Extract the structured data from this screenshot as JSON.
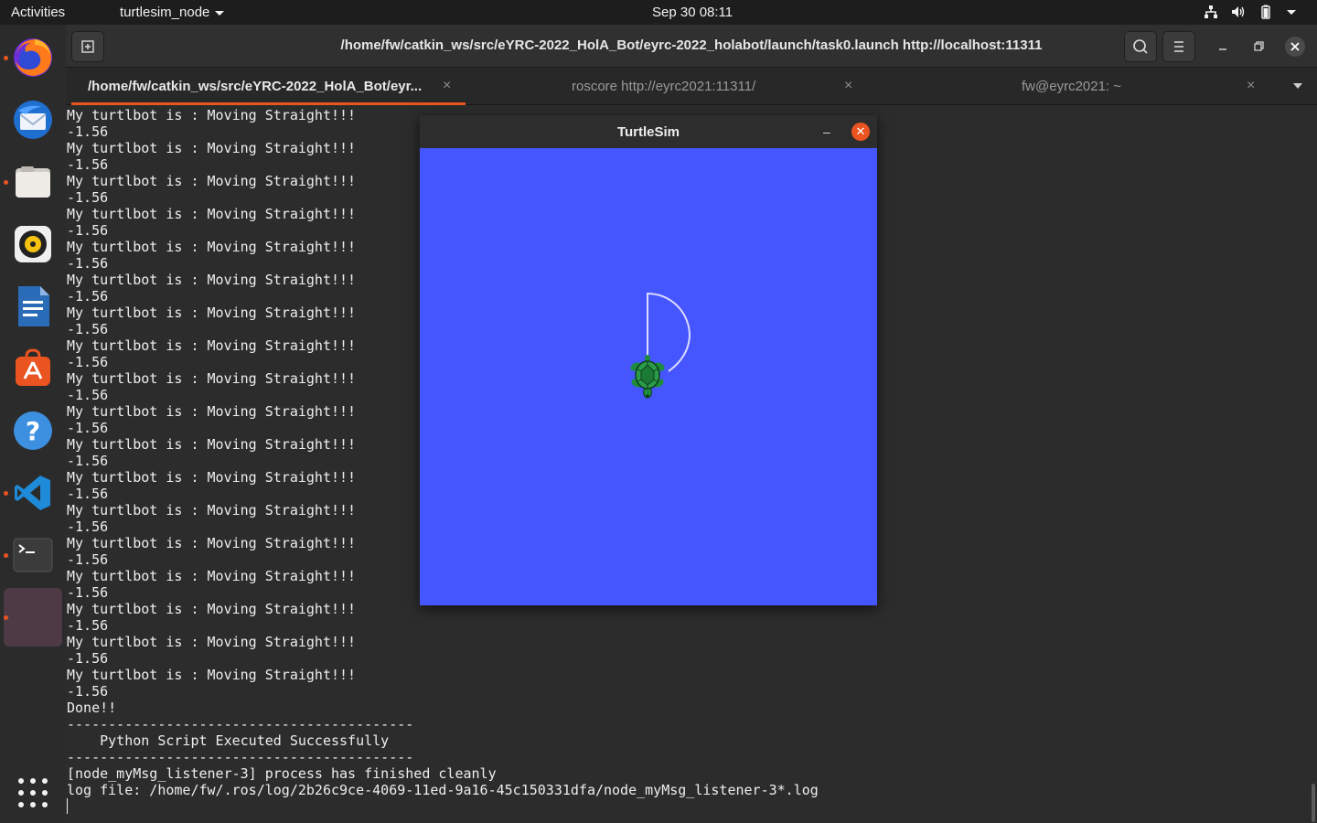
{
  "topbar": {
    "activities": "Activities",
    "app_menu": "turtlesim_node",
    "clock": "Sep 30  08:11",
    "tray_icons": [
      "network-icon",
      "volume-icon",
      "battery-icon",
      "system-menu-icon"
    ]
  },
  "dock": {
    "apps": [
      {
        "name": "firefox-icon",
        "running": true
      },
      {
        "name": "thunderbird-icon",
        "running": false
      },
      {
        "name": "files-icon",
        "running": true
      },
      {
        "name": "rhythmbox-icon",
        "running": false
      },
      {
        "name": "libreoffice-writer-icon",
        "running": false
      },
      {
        "name": "software-center-icon",
        "running": false
      },
      {
        "name": "help-icon",
        "running": false
      },
      {
        "name": "vscode-icon",
        "running": true
      },
      {
        "name": "terminal-icon",
        "running": true
      },
      {
        "name": "turtlesim-app-icon",
        "running": true
      }
    ],
    "show_apps_icon": "apps-grid-icon"
  },
  "terminal": {
    "title": "/home/fw/catkin_ws/src/eYRC-2022_HolA_Bot/eyrc-2022_holabot/launch/task0.launch http://localhost:11311",
    "tabs": [
      {
        "label": "/home/fw/catkin_ws/src/eYRC-2022_HolA_Bot/eyr...",
        "active": true
      },
      {
        "label": "roscore http://eyrc2021:11311/",
        "active": false
      },
      {
        "label": "fw@eyrc2021: ~",
        "active": false
      }
    ],
    "output_lines": [
      "My turtlbot is : Moving Straight!!!",
      "-1.56",
      "My turtlbot is : Moving Straight!!!",
      "-1.56",
      "My turtlbot is : Moving Straight!!!",
      "-1.56",
      "My turtlbot is : Moving Straight!!!",
      "-1.56",
      "My turtlbot is : Moving Straight!!!",
      "-1.56",
      "My turtlbot is : Moving Straight!!!",
      "-1.56",
      "My turtlbot is : Moving Straight!!!",
      "-1.56",
      "My turtlbot is : Moving Straight!!!",
      "-1.56",
      "My turtlbot is : Moving Straight!!!",
      "-1.56",
      "My turtlbot is : Moving Straight!!!",
      "-1.56",
      "My turtlbot is : Moving Straight!!!",
      "-1.56",
      "My turtlbot is : Moving Straight!!!",
      "-1.56",
      "My turtlbot is : Moving Straight!!!",
      "-1.56",
      "My turtlbot is : Moving Straight!!!",
      "-1.56",
      "My turtlbot is : Moving Straight!!!",
      "-1.56",
      "My turtlbot is : Moving Straight!!!",
      "-1.56",
      "My turtlbot is : Moving Straight!!!",
      "-1.56",
      "My turtlbot is : Moving Straight!!!",
      "-1.56",
      "Done!!",
      "------------------------------------------",
      "    Python Script Executed Successfully",
      "------------------------------------------",
      "[node_myMsg_listener-3] process has finished cleanly",
      "log file: /home/fw/.ros/log/2b26c9ce-4069-11ed-9a16-45c150331dfa/node_myMsg_listener-3*.log"
    ]
  },
  "turtlesim": {
    "title": "TurtleSim",
    "background": "#4556ff",
    "trail_color": "#dcdcff",
    "turtle_color": "#1e8c3c"
  }
}
